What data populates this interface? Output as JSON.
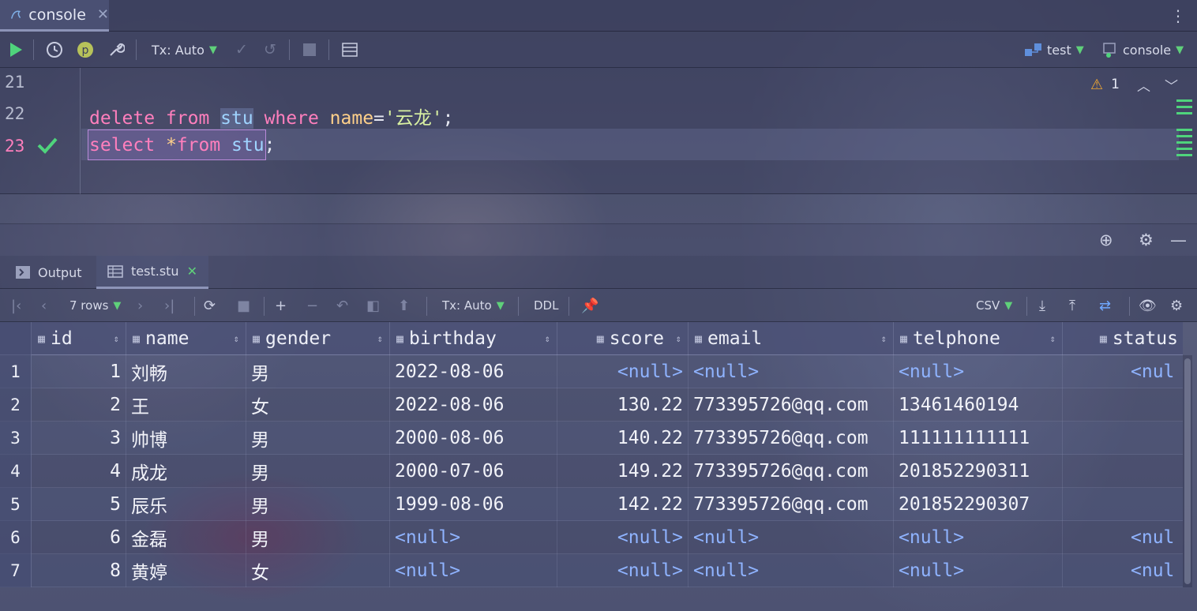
{
  "tabbar": {
    "tab_label": "console",
    "tab_icon": "mysql-dolphin-icon",
    "close_glyph": "✕",
    "menu_glyph": "⋮"
  },
  "console_toolbar": {
    "tx_label": "Tx: Auto",
    "datasource_label": "test",
    "session_label": "console"
  },
  "editor": {
    "lines": [
      {
        "number": "21",
        "text": ""
      },
      {
        "number": "22",
        "text": "delete from stu where name='云龙';"
      },
      {
        "number": "23",
        "text": "select *from stu;"
      }
    ],
    "warning_count": "1"
  },
  "results": {
    "tabs": [
      {
        "label": "Output"
      },
      {
        "label": "test.stu"
      }
    ],
    "toolbar": {
      "rows_label": "7 rows",
      "tx_label": "Tx: Auto",
      "ddl_label": "DDL",
      "export_format": "CSV"
    },
    "columns": [
      "id",
      "name",
      "gender",
      "birthday",
      "score",
      "email",
      "telphone",
      "status"
    ],
    "rows": [
      {
        "n": "1",
        "id": "1",
        "name": "刘畅",
        "gender": "男",
        "birthday": "2022-08-06",
        "score": "<null>",
        "email": "<null>",
        "telphone": "<null>",
        "status": "<nul"
      },
      {
        "n": "2",
        "id": "2",
        "name": "王",
        "gender": "女",
        "birthday": "2022-08-06",
        "score": "130.22",
        "email": "773395726@qq.com",
        "telphone": "13461460194",
        "status": ""
      },
      {
        "n": "3",
        "id": "3",
        "name": "帅博",
        "gender": "男",
        "birthday": "2000-08-06",
        "score": "140.22",
        "email": "773395726@qq.com",
        "telphone": "111111111111",
        "status": ""
      },
      {
        "n": "4",
        "id": "4",
        "name": "成龙",
        "gender": "男",
        "birthday": "2000-07-06",
        "score": "149.22",
        "email": "773395726@qq.com",
        "telphone": "201852290311",
        "status": ""
      },
      {
        "n": "5",
        "id": "5",
        "name": "辰乐",
        "gender": "男",
        "birthday": "1999-08-06",
        "score": "142.22",
        "email": "773395726@qq.com",
        "telphone": "201852290307",
        "status": ""
      },
      {
        "n": "6",
        "id": "6",
        "name": "金磊",
        "gender": "男",
        "birthday": "<null>",
        "score": "<null>",
        "email": "<null>",
        "telphone": "<null>",
        "status": "<nul"
      },
      {
        "n": "7",
        "id": "8",
        "name": "黄婷",
        "gender": "女",
        "birthday": "<null>",
        "score": "<null>",
        "email": "<null>",
        "telphone": "<null>",
        "status": "<nul"
      }
    ]
  },
  "colors": {
    "keyword": "#ff7fbd",
    "null_value": "#8fb3ff",
    "run_green": "#4fd47c",
    "warning": "#f0a832"
  }
}
